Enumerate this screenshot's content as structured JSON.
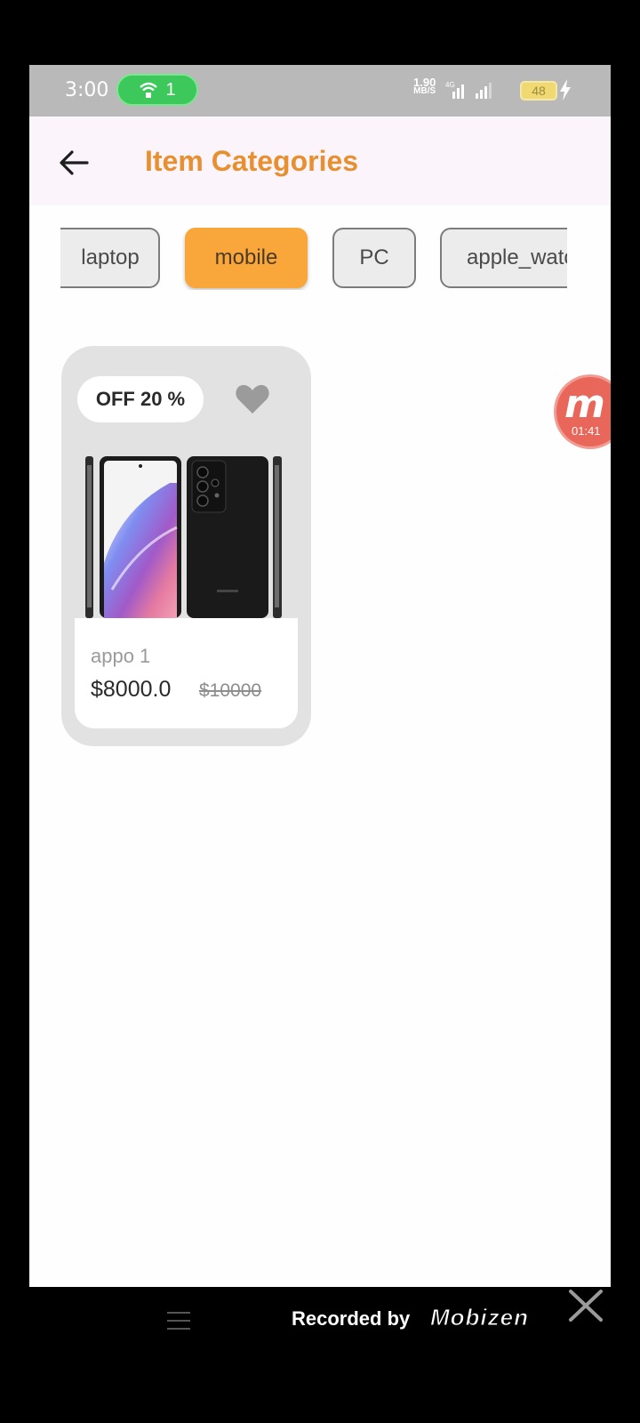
{
  "status_bar": {
    "time": "3:00",
    "hotspot_count": "1",
    "net_speed_value": "1.90",
    "net_speed_unit": "MB/S",
    "battery": "48"
  },
  "app_bar": {
    "title": "Item Categories"
  },
  "categories": [
    {
      "label": "laptop",
      "active": false
    },
    {
      "label": "mobile",
      "active": true
    },
    {
      "label": "PC",
      "active": false
    },
    {
      "label": "apple_watch",
      "active": false
    }
  ],
  "product": {
    "discount": "OFF 20 %",
    "name": "appo 1",
    "price": "$8000.0",
    "old_price": "$10000"
  },
  "recorder": {
    "letter": "m",
    "elapsed": "01:41"
  },
  "footer": {
    "recorded_by": "Recorded by",
    "brand": "Mobizen"
  },
  "colors": {
    "accent": "#e88f2f",
    "chip_active": "#f9a63a",
    "card_bg": "#e2e2e2"
  }
}
